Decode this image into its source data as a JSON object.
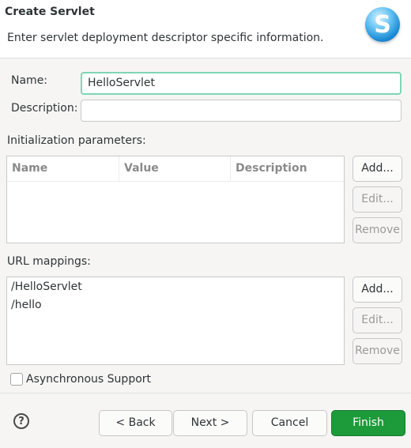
{
  "dialog": {
    "title": "Create Servlet",
    "message": "Enter servlet deployment descriptor specific information.",
    "logo_letter": "S",
    "logo_icon": "servlet-wizard-icon"
  },
  "form": {
    "name_label": "Name:",
    "name_value": "HelloServlet",
    "description_label": "Description:",
    "description_value": ""
  },
  "init_params": {
    "label": "Initialization parameters:",
    "columns": [
      "Name",
      "Value",
      "Description"
    ],
    "rows": [],
    "add_label": "Add...",
    "edit_label": "Edit...",
    "remove_label": "Remove"
  },
  "url_mappings": {
    "label": "URL mappings:",
    "items": [
      "/HelloServlet",
      "/hello"
    ],
    "add_label": "Add...",
    "edit_label": "Edit...",
    "remove_label": "Remove"
  },
  "async": {
    "label": "Asynchronous Support",
    "checked": false
  },
  "footer": {
    "help_icon": "help-icon",
    "help_glyph": "?",
    "back_label": "< Back",
    "next_label": "Next >",
    "cancel_label": "Cancel",
    "finish_label": "Finish",
    "finish_color": "#1d9a3a"
  }
}
